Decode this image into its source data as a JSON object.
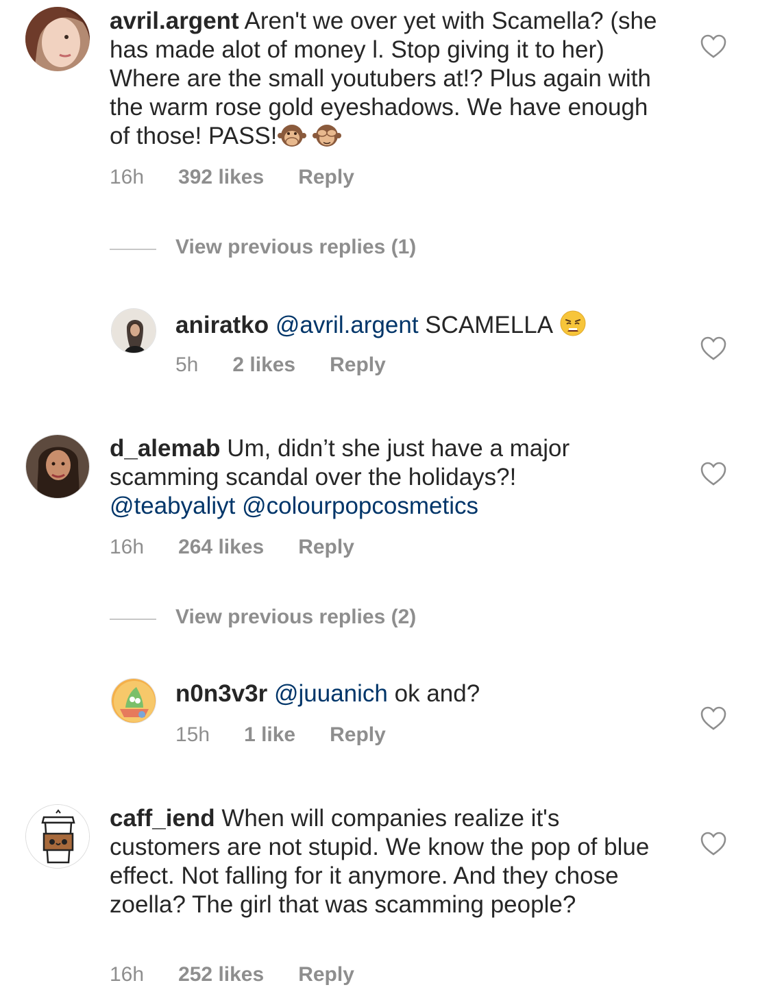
{
  "comments": [
    {
      "username": "avril.argent",
      "text": "Aren't we over yet with Scamella? (she has made alot of money l. Stop giving it to her) Where are the small youtubers at!? Plus again with the warm rose gold eyeshadows. We have enough of those! PASS!",
      "time": "16h",
      "likes": "392 likes",
      "reply": "Reply",
      "emojis": [
        "speak-no-evil-monkey",
        "see-no-evil-monkey"
      ]
    },
    {
      "username": "d_alemab",
      "text": "Um, didn’t she just have a major scamming scandal over the holidays?!",
      "mentions": [
        "@teabyaliyt",
        "@colourpopcosmetics"
      ],
      "time": "16h",
      "likes": "264 likes",
      "reply": "Reply"
    },
    {
      "username": "caff_iend",
      "text": "When will companies realize it's customers are not stupid. We know the pop of blue effect. Not falling for it anymore. And they chose zoella? The girl that was scamming people?",
      "time": "16h",
      "likes": "252 likes",
      "reply": "Reply"
    }
  ],
  "replies": [
    {
      "username": "aniratko",
      "mention": "@avril.argent",
      "text": "SCAMELLA",
      "emoji": "weary-face",
      "time": "5h",
      "likes": "2 likes",
      "reply": "Reply"
    },
    {
      "username": "n0n3v3r",
      "mention": "@juuanich",
      "text": "ok and?",
      "time": "15h",
      "likes": "1 like",
      "reply": "Reply"
    }
  ],
  "view_previous": [
    "View previous replies (1)",
    "View previous replies (2)"
  ],
  "colors": {
    "text": "#262626",
    "muted": "#8e8e8e",
    "mention": "#003569",
    "divider": "#c7c7c7"
  },
  "icons": {
    "like": "heart-outline-icon"
  }
}
